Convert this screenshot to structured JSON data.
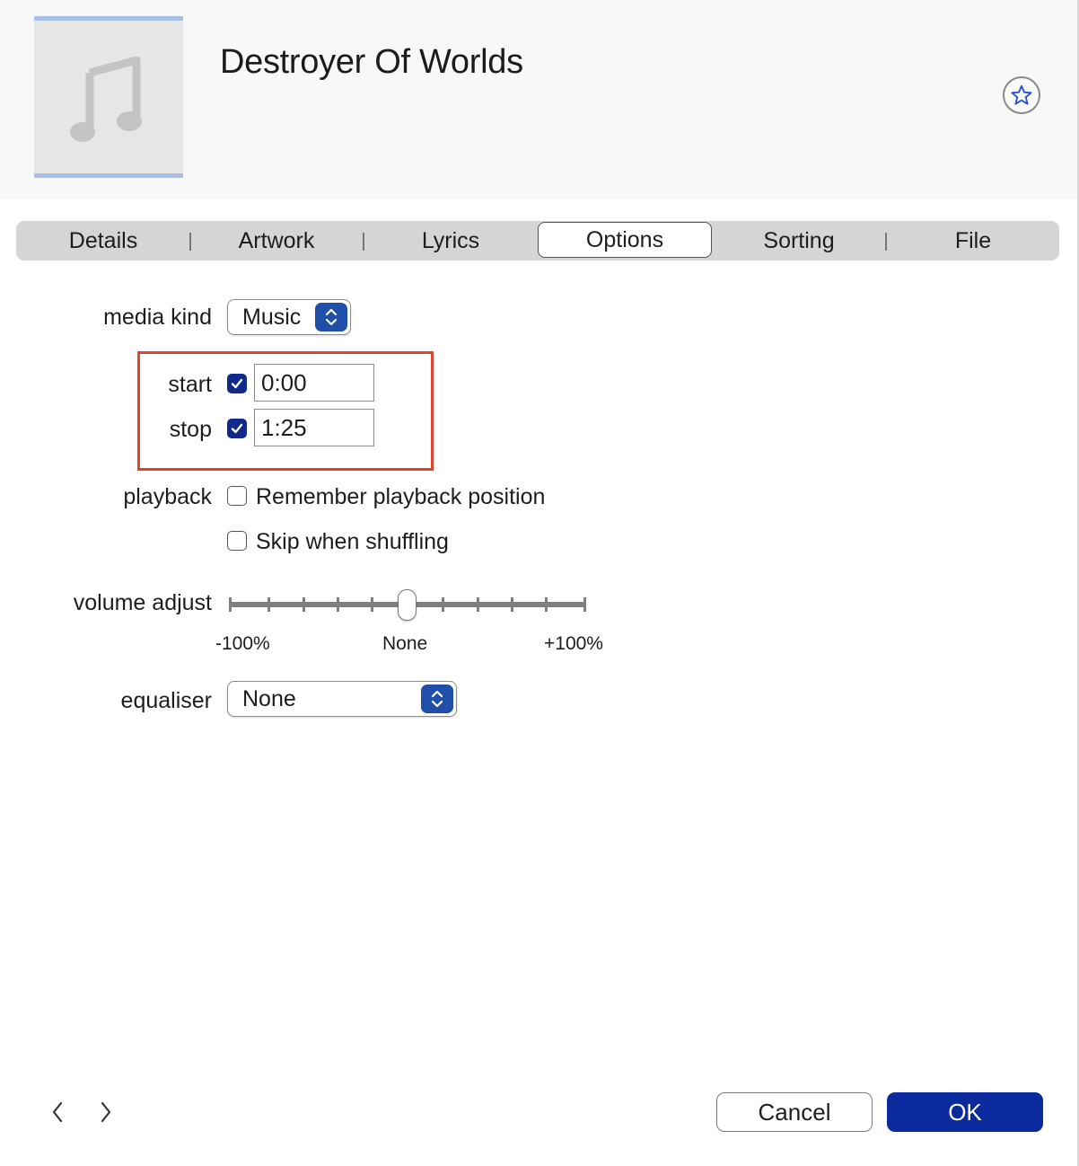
{
  "header": {
    "title": "Destroyer Of Worlds",
    "artwork_icon": "music-note-icon",
    "star_icon": "star-icon"
  },
  "tabs": [
    {
      "label": "Details",
      "active": false
    },
    {
      "label": "Artwork",
      "active": false
    },
    {
      "label": "Lyrics",
      "active": false
    },
    {
      "label": "Options",
      "active": true
    },
    {
      "label": "Sorting",
      "active": false
    },
    {
      "label": "File",
      "active": false
    }
  ],
  "options": {
    "media_kind": {
      "label": "media kind",
      "value": "Music"
    },
    "start": {
      "label": "start",
      "checked": true,
      "value": "0:00"
    },
    "stop": {
      "label": "stop",
      "checked": true,
      "value": "1:25"
    },
    "playback": {
      "label": "playback",
      "remember_position": {
        "label": "Remember playback position",
        "checked": false
      },
      "skip_shuffling": {
        "label": "Skip when shuffling",
        "checked": false
      }
    },
    "volume_adjust": {
      "label": "volume adjust",
      "value_percent": 0,
      "min_label": "-100%",
      "mid_label": "None",
      "max_label": "+100%"
    },
    "equaliser": {
      "label": "equaliser",
      "value": "None"
    }
  },
  "footer": {
    "cancel_label": "Cancel",
    "ok_label": "OK",
    "prev_icon": "chevron-left-icon",
    "next_icon": "chevron-right-icon"
  },
  "colors": {
    "accent": "#0a2a9e",
    "highlight": "#e0442f",
    "artwork_border": "#a7bfe6"
  }
}
